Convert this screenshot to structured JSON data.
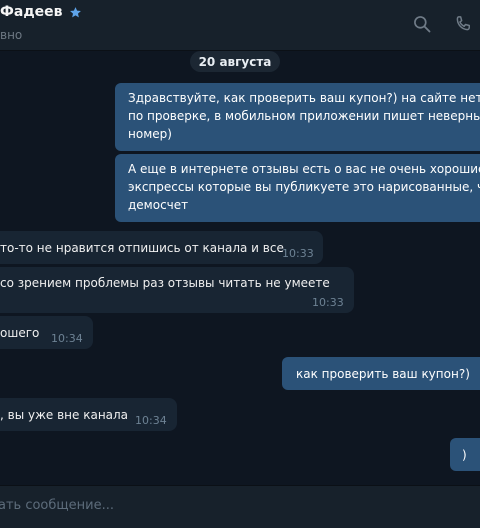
{
  "header": {
    "title": "Фадеев",
    "status": "вно",
    "verified_icon": "star-icon",
    "search_icon": "search-icon",
    "call_icon": "phone-icon"
  },
  "date_separator": "20 августа",
  "messages": [
    {
      "direction": "out",
      "lines": [
        "Здравствуйте, как проверить ваш купон?) на сайте нет р",
        "по проверке, в мобильном приложении пишет неверны",
        "номер)"
      ]
    },
    {
      "direction": "out",
      "lines": [
        "А еще в интернете отзывы есть о вас не очень хорошие)",
        "экспрессы которые вы публикуете это нарисованные, че",
        "демосчет"
      ]
    },
    {
      "direction": "in",
      "lines": [
        "то-то не нравится отпишись от канала и все"
      ],
      "time": "10:33"
    },
    {
      "direction": "in",
      "lines": [
        "со зрением проблемы раз отзывы читать не умеете"
      ],
      "time": "10:33"
    },
    {
      "direction": "in",
      "lines": [
        "ошего"
      ],
      "time": "10:34"
    },
    {
      "direction": "out",
      "lines": [
        "как проверить ваш купон?)"
      ]
    },
    {
      "direction": "in",
      "lines": [
        ", вы уже вне канала"
      ],
      "time": "10:34"
    },
    {
      "direction": "out",
      "lines": [
        ")"
      ]
    }
  ],
  "composer": {
    "placeholder": "ать сообщение..."
  },
  "colors": {
    "background": "#0e1621",
    "header": "#17212b",
    "outgoing_bubble": "#2b5278",
    "incoming_bubble": "#182533",
    "verified_star": "#5ea3e8"
  }
}
